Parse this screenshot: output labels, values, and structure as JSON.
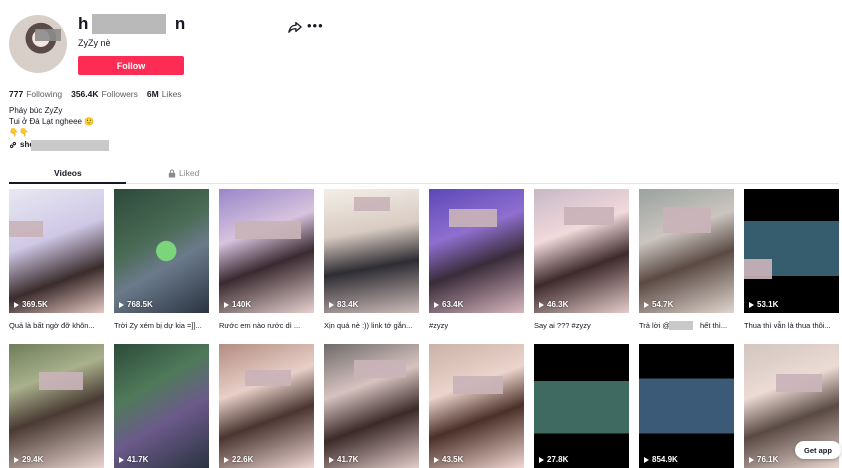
{
  "profile": {
    "username_visible_start": "h",
    "username_visible_end": "n",
    "nickname": "ZyZy nè",
    "follow_label": "Follow",
    "stats": [
      {
        "value": "777",
        "label": "Following"
      },
      {
        "value": "356.4K",
        "label": "Followers"
      },
      {
        "value": "6M",
        "label": "Likes"
      }
    ],
    "bio_lines": [
      "Pháy búc ZyZy",
      "Tui ở Đà Lạt ngheee 🙂",
      "👇👇"
    ],
    "link_prefix": "she"
  },
  "tabs": {
    "videos": "Videos",
    "liked": "Liked"
  },
  "videos": [
    {
      "views": "369.5K",
      "caption": "Quả là bất ngờ đỡ khôn..."
    },
    {
      "views": "768.5K",
      "caption": "Trời Zy xém bị dự kia =]]..."
    },
    {
      "views": "140K",
      "caption": "Rước em nào rước dì ..."
    },
    {
      "views": "83.4K",
      "caption": "Xịn quá nè :)) link tớ gắn..."
    },
    {
      "views": "63.4K",
      "caption": "#zyzy"
    },
    {
      "views": "46.3K",
      "caption": "Say ai ??? #zyzy"
    },
    {
      "views": "54.7K",
      "caption_start": "Trả lời @",
      "caption_end": "hết thì..."
    },
    {
      "views": "53.1K",
      "caption": "Thua thì vẫn là thua thôi..."
    },
    {
      "views": "29.4K"
    },
    {
      "views": "41.7K"
    },
    {
      "views": "22.6K"
    },
    {
      "views": "41.7K"
    },
    {
      "views": "43.5K"
    },
    {
      "views": "27.8K"
    },
    {
      "views": "854.9K"
    },
    {
      "views": "76.1K"
    }
  ],
  "get_app_label": "Get app",
  "icons": {
    "share": "share-icon",
    "more": "more-icon",
    "lock": "lock-icon",
    "link": "link-icon",
    "play": "play-icon"
  }
}
